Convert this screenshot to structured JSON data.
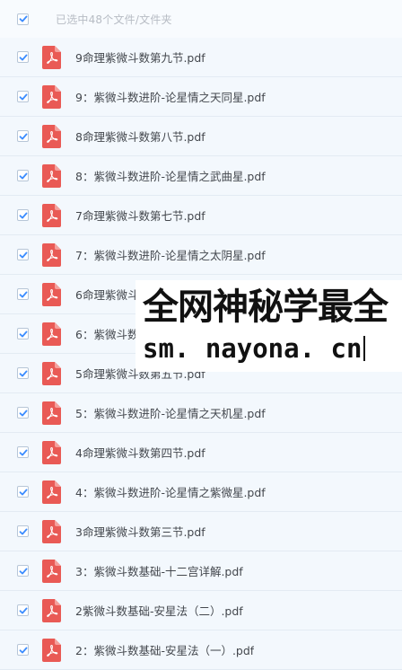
{
  "colors": {
    "accent": "#3b8cff",
    "pdf_icon": "#e95a55",
    "row_background": "#f3f8fd",
    "header_text": "#b7bcc4"
  },
  "header": {
    "selection_text": "已选中48个文件/文件夹",
    "select_all_checked": true
  },
  "files": [
    {
      "name": "9命理紫微斗数第九节.pdf",
      "checked": true,
      "icon": "pdf-icon"
    },
    {
      "name": "9：紫微斗数进阶-论星情之天同星.pdf",
      "checked": true,
      "icon": "pdf-icon"
    },
    {
      "name": "8命理紫微斗数第八节.pdf",
      "checked": true,
      "icon": "pdf-icon"
    },
    {
      "name": "8：紫微斗数进阶-论星情之武曲星.pdf",
      "checked": true,
      "icon": "pdf-icon"
    },
    {
      "name": "7命理紫微斗数第七节.pdf",
      "checked": true,
      "icon": "pdf-icon"
    },
    {
      "name": "7：紫微斗数进阶-论星情之太阴星.pdf",
      "checked": true,
      "icon": "pdf-icon"
    },
    {
      "name": "6命理紫微斗",
      "checked": true,
      "icon": "pdf-icon"
    },
    {
      "name": "6：紫微斗数",
      "checked": true,
      "icon": "pdf-icon"
    },
    {
      "name": "5命理紫微斗数第五节.pdf",
      "checked": true,
      "icon": "pdf-icon"
    },
    {
      "name": "5：紫微斗数进阶-论星情之天机星.pdf",
      "checked": true,
      "icon": "pdf-icon"
    },
    {
      "name": "4命理紫微斗数第四节.pdf",
      "checked": true,
      "icon": "pdf-icon"
    },
    {
      "name": "4：紫微斗数进阶-论星情之紫微星.pdf",
      "checked": true,
      "icon": "pdf-icon"
    },
    {
      "name": "3命理紫微斗数第三节.pdf",
      "checked": true,
      "icon": "pdf-icon"
    },
    {
      "name": "3：紫微斗数基础-十二宫详解.pdf",
      "checked": true,
      "icon": "pdf-icon"
    },
    {
      "name": "2紫微斗数基础-安星法（二）.pdf",
      "checked": true,
      "icon": "pdf-icon"
    },
    {
      "name": "2：紫微斗数基础-安星法（一）.pdf",
      "checked": true,
      "icon": "pdf-icon"
    }
  ],
  "watermark": {
    "line1": "全网神秘学最全",
    "line2": "sm. nayona. cn"
  }
}
